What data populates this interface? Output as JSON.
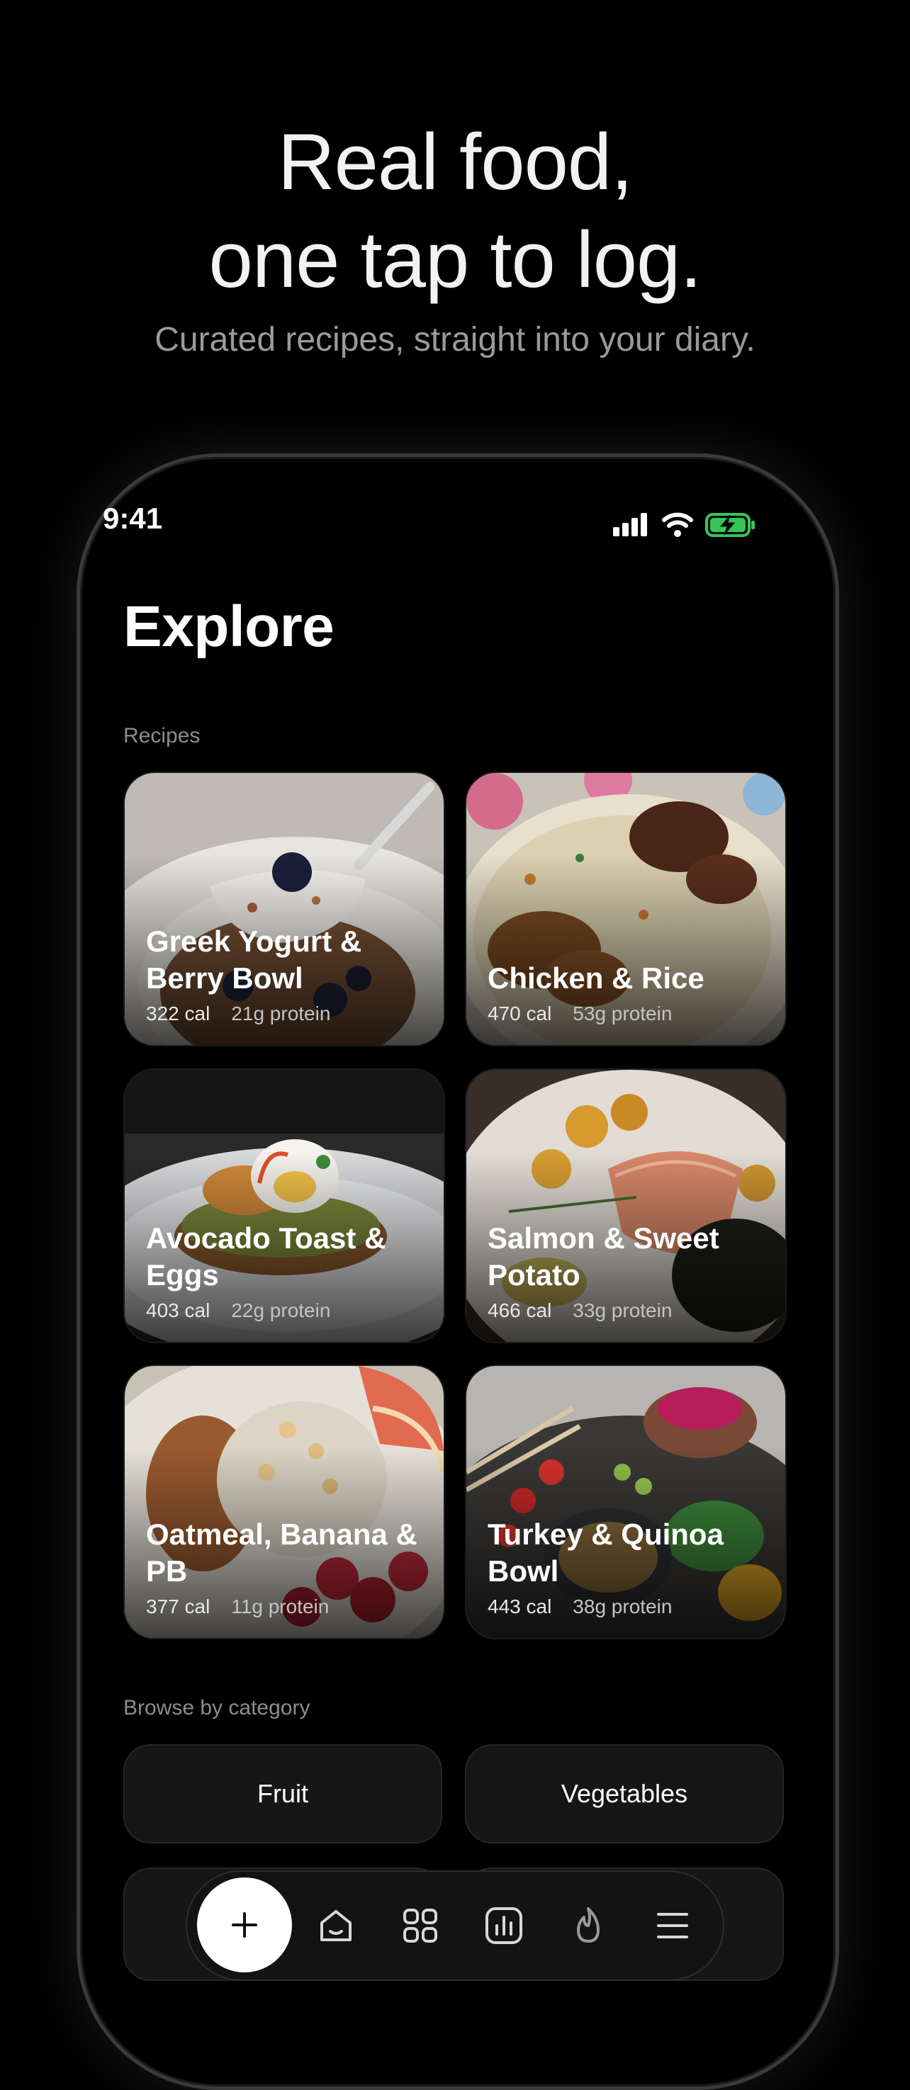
{
  "hero": {
    "title_line1": "Real food,",
    "title_line2": "one tap to log.",
    "subtitle": "Curated recipes, straight into your diary."
  },
  "status_bar": {
    "time": "9:41",
    "icons": [
      "cellular-signal-icon",
      "wifi-icon",
      "battery-charging-icon"
    ],
    "battery_color": "#34c759"
  },
  "page": {
    "title": "Explore"
  },
  "recipes": {
    "label": "Recipes",
    "items": [
      {
        "title": "Greek Yogurt & Berry Bowl",
        "calories": "322 cal",
        "protein": "21g protein"
      },
      {
        "title": "Chicken & Rice",
        "calories": "470 cal",
        "protein": "53g protein"
      },
      {
        "title": "Avocado Toast & Eggs",
        "calories": "403 cal",
        "protein": "22g protein"
      },
      {
        "title": "Salmon & Sweet Potato",
        "calories": "466 cal",
        "protein": "33g protein"
      },
      {
        "title": "Oatmeal, Banana & PB",
        "calories": "377 cal",
        "protein": "11g protein"
      },
      {
        "title": "Turkey & Quinoa Bowl",
        "calories": "443 cal",
        "protein": "38g protein"
      }
    ]
  },
  "categories": {
    "label": "Browse by category",
    "items": [
      "Fruit",
      "Vegetables"
    ]
  },
  "tab_bar": {
    "items": [
      "add-icon",
      "home-icon",
      "grid-icon",
      "chart-icon",
      "flame-icon",
      "menu-icon"
    ]
  },
  "colors": {
    "background": "#000000",
    "accent": "#ffffff",
    "muted_text": "#8c8c8c",
    "surface": "#161616"
  }
}
